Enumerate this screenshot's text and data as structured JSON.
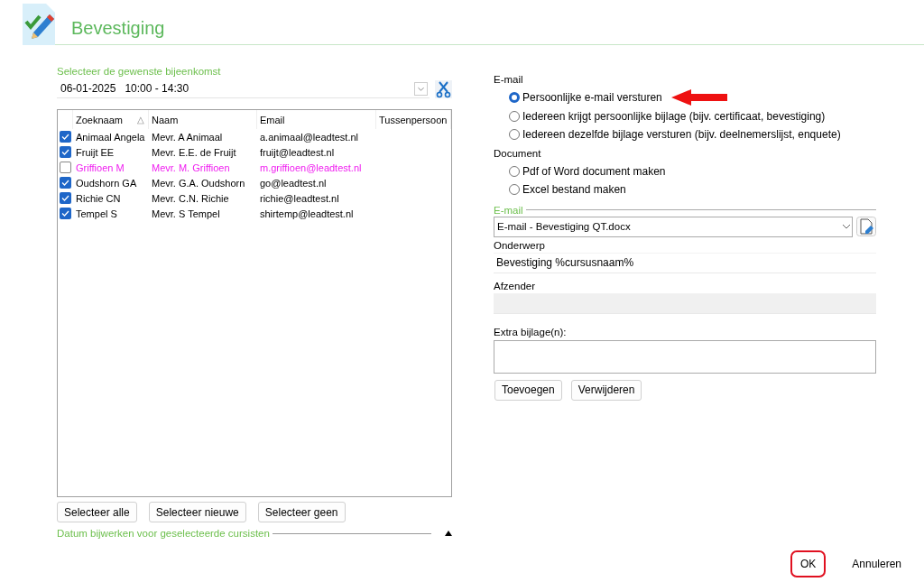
{
  "window": {
    "title": "Bevestiging"
  },
  "meeting": {
    "label": "Selecteer de gewenste bijeenkomst",
    "value": "06-01-2025   10:00 - 14:30"
  },
  "table": {
    "columns": [
      {
        "label": "Zoeknaam",
        "sort_mark": "△"
      },
      {
        "label": "Naam"
      },
      {
        "label": "Email"
      },
      {
        "label": "Tussenpersoon"
      }
    ],
    "rows": [
      {
        "checked": true,
        "highlighted": false,
        "cells": [
          "Animaal Angela",
          "Mevr. A Animaal",
          "a.animaal@leadtest.nl"
        ]
      },
      {
        "checked": true,
        "highlighted": false,
        "cells": [
          "Fruijt EE",
          "Mevr. E.E. de Fruijt",
          "fruijt@leadtest.nl"
        ]
      },
      {
        "checked": false,
        "highlighted": true,
        "cells": [
          "Griffioen M",
          "Mevr. M. Griffioen",
          "m.griffioen@leadtest.nl"
        ]
      },
      {
        "checked": true,
        "highlighted": false,
        "cells": [
          "Oudshorn GA",
          "Mevr. G.A. Oudshorn",
          "go@leadtest.nl"
        ]
      },
      {
        "checked": true,
        "highlighted": false,
        "cells": [
          "Richie CN",
          "Mevr. C.N. Richie",
          "richie@leadtest.nl"
        ]
      },
      {
        "checked": true,
        "highlighted": false,
        "cells": [
          "Tempel S",
          "Mevr. S Tempel",
          "shirtemp@leadtest.nl"
        ]
      }
    ]
  },
  "select_buttons": [
    "Selecteer alle",
    "Selecteer nieuwe",
    "Selecteer geen"
  ],
  "date_section": {
    "label": "Datum bijwerken voor geselecteerde cursisten",
    "expanded": false
  },
  "options": [
    {
      "kind": "heading",
      "label": "E-mail"
    },
    {
      "kind": "radio",
      "label": "Persoonlijke e-mail versturen",
      "selected": true,
      "pointed_at": true
    },
    {
      "kind": "radio",
      "label": "Iedereen krijgt persoonlijke bijlage (bijv. certificaat, bevestiging)",
      "selected": false,
      "pointed_at": false
    },
    {
      "kind": "radio",
      "label": "Iedereen dezelfde bijlage versturen (bijv. deelnemerslijst, enquete)",
      "selected": false,
      "pointed_at": false
    },
    {
      "kind": "heading",
      "label": "Document"
    },
    {
      "kind": "radio",
      "label": "Pdf of Word document maken",
      "selected": false,
      "pointed_at": false
    },
    {
      "kind": "radio",
      "label": "Excel bestand maken",
      "selected": false,
      "pointed_at": false
    }
  ],
  "email": {
    "section": "E-mail",
    "template": "E-mail - Bevestiging QT.docx",
    "subject_label": "Onderwerp",
    "subject": "Bevestiging %cursusnaam%",
    "sender_label": "Afzender",
    "sender_disabled": true,
    "attachments_label": "Extra bijlage(n):",
    "buttons": [
      "Toevoegen",
      "Verwijderen"
    ]
  },
  "footer": {
    "buttons": [
      {
        "label": "OK",
        "circled": true
      },
      {
        "label": "Annuleren",
        "circled": false
      }
    ]
  }
}
